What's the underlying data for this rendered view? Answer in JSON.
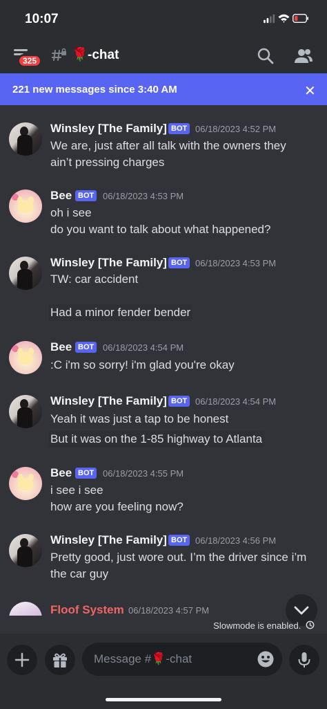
{
  "status_bar": {
    "time": "10:07"
  },
  "header": {
    "unread_badge": "325",
    "channel_emoji": "🌹",
    "channel_name": "-chat"
  },
  "new_messages_bar": {
    "text": "221 new messages since 3:40 AM",
    "close_label": "✕"
  },
  "messages": [
    {
      "author": "Winsley [The Family]",
      "bot": "BOT",
      "time": "06/18/2023 4:52 PM",
      "lines": [
        "We are, just after all talk with the owners they",
        "ain’t pressing charges"
      ]
    },
    {
      "author": "Bee",
      "bot": "BOT",
      "time": "06/18/2023 4:53 PM",
      "lines": [
        "oh i see",
        "do you want to talk about what happened?"
      ]
    },
    {
      "author": "Winsley [The Family]",
      "bot": "BOT",
      "time": "06/18/2023 4:53 PM",
      "lines": [
        "TW: car accident",
        "Had a minor fender bender"
      ]
    },
    {
      "author": "Bee",
      "bot": "BOT",
      "time": "06/18/2023 4:54 PM",
      "lines": [
        ":C i'm so sorry! i'm glad you're okay"
      ]
    },
    {
      "author": "Winsley [The Family]",
      "bot": "BOT",
      "time": "06/18/2023 4:54 PM",
      "lines": [
        "Yeah it was just a tap to be honest",
        "But it was on the 1-85 highway to Atlanta"
      ]
    },
    {
      "author": "Bee",
      "bot": "BOT",
      "time": "06/18/2023 4:55 PM",
      "lines": [
        "i see i see",
        "how are you feeling now?"
      ]
    },
    {
      "author": "Winsley [The Family]",
      "bot": "BOT",
      "time": "06/18/2023 4:56 PM",
      "lines": [
        "Pretty good, just wore out. I’m the driver since i’m",
        "the car guy"
      ]
    },
    {
      "author": "Floof System",
      "time": "06/18/2023 4:57 PM",
      "lines": []
    }
  ],
  "slowmode_text": "Slowmode is enabled.",
  "composer": {
    "placeholder": "Message #🌹-chat"
  },
  "colors": {
    "background": "#313338",
    "accent": "#5865f2",
    "red_author": "#f06565"
  },
  "icons": [
    "menu-icon",
    "hash-lock-icon",
    "search-icon",
    "members-icon",
    "close-icon",
    "chevron-down-icon",
    "clock-icon",
    "plus-icon",
    "gift-icon",
    "emoji-icon",
    "microphone-icon"
  ]
}
